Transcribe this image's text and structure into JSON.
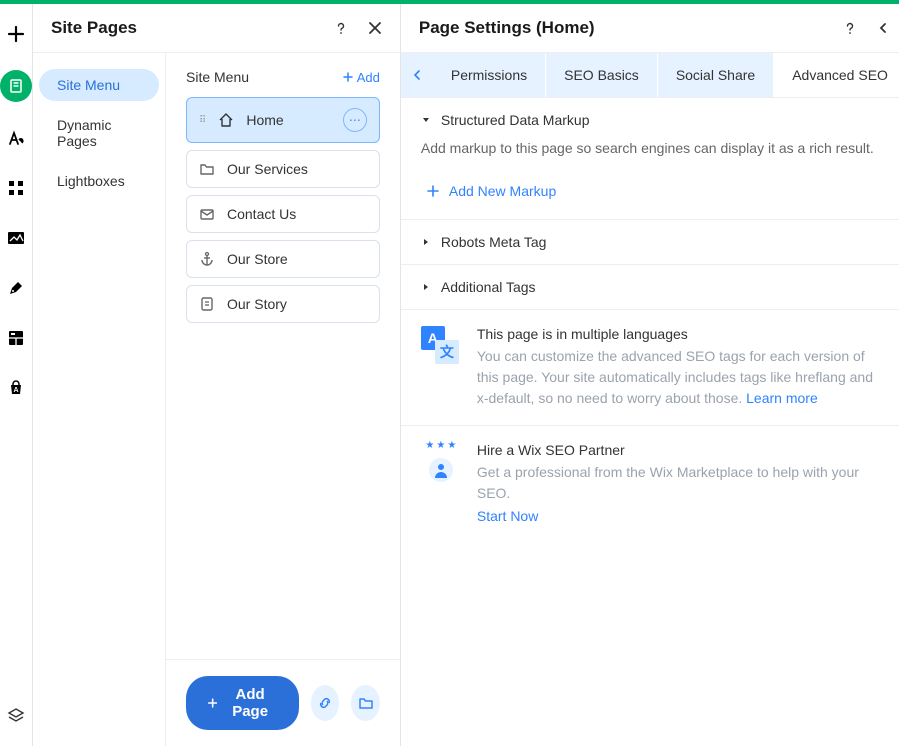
{
  "header": {
    "site_pages_title": "Site Pages",
    "page_settings_title": "Page Settings (Home)"
  },
  "page_nav": {
    "items": [
      {
        "label": "Site Menu",
        "active": true
      },
      {
        "label": "Dynamic Pages",
        "active": false
      },
      {
        "label": "Lightboxes",
        "active": false
      }
    ]
  },
  "content": {
    "title": "Site Menu",
    "add_label": "Add"
  },
  "pages": [
    {
      "label": "Home",
      "icon": "home",
      "selected": true
    },
    {
      "label": "Our Services",
      "icon": "folder",
      "selected": false
    },
    {
      "label": "Contact Us",
      "icon": "mail",
      "selected": false
    },
    {
      "label": "Our Store",
      "icon": "anchor",
      "selected": false
    },
    {
      "label": "Our Story",
      "icon": "page",
      "selected": false
    }
  ],
  "footer": {
    "add_page_label": "Add Page"
  },
  "tabs": {
    "items": [
      {
        "label": "Permissions",
        "active": false
      },
      {
        "label": "SEO Basics",
        "active": false
      },
      {
        "label": "Social Share",
        "active": false
      },
      {
        "label": "Advanced SEO",
        "active": true
      }
    ]
  },
  "sections": {
    "structured_data": {
      "title": "Structured Data Markup",
      "desc": "Add markup to this page so search engines can display it as a rich result.",
      "add_label": "Add New Markup"
    },
    "robots": {
      "title": "Robots Meta Tag"
    },
    "additional": {
      "title": "Additional Tags"
    }
  },
  "multilang": {
    "title": "This page is in multiple languages",
    "desc": "You can customize the advanced SEO tags for each version of this page. Your site automatically includes tags like hreflang and x-default, so no need to worry about those.",
    "link": "Learn more",
    "badge_a": "A",
    "badge_b": "文"
  },
  "partner": {
    "title": "Hire a Wix SEO Partner",
    "desc": "Get a professional from the Wix Marketplace to help with your SEO.",
    "cta": "Start Now"
  }
}
